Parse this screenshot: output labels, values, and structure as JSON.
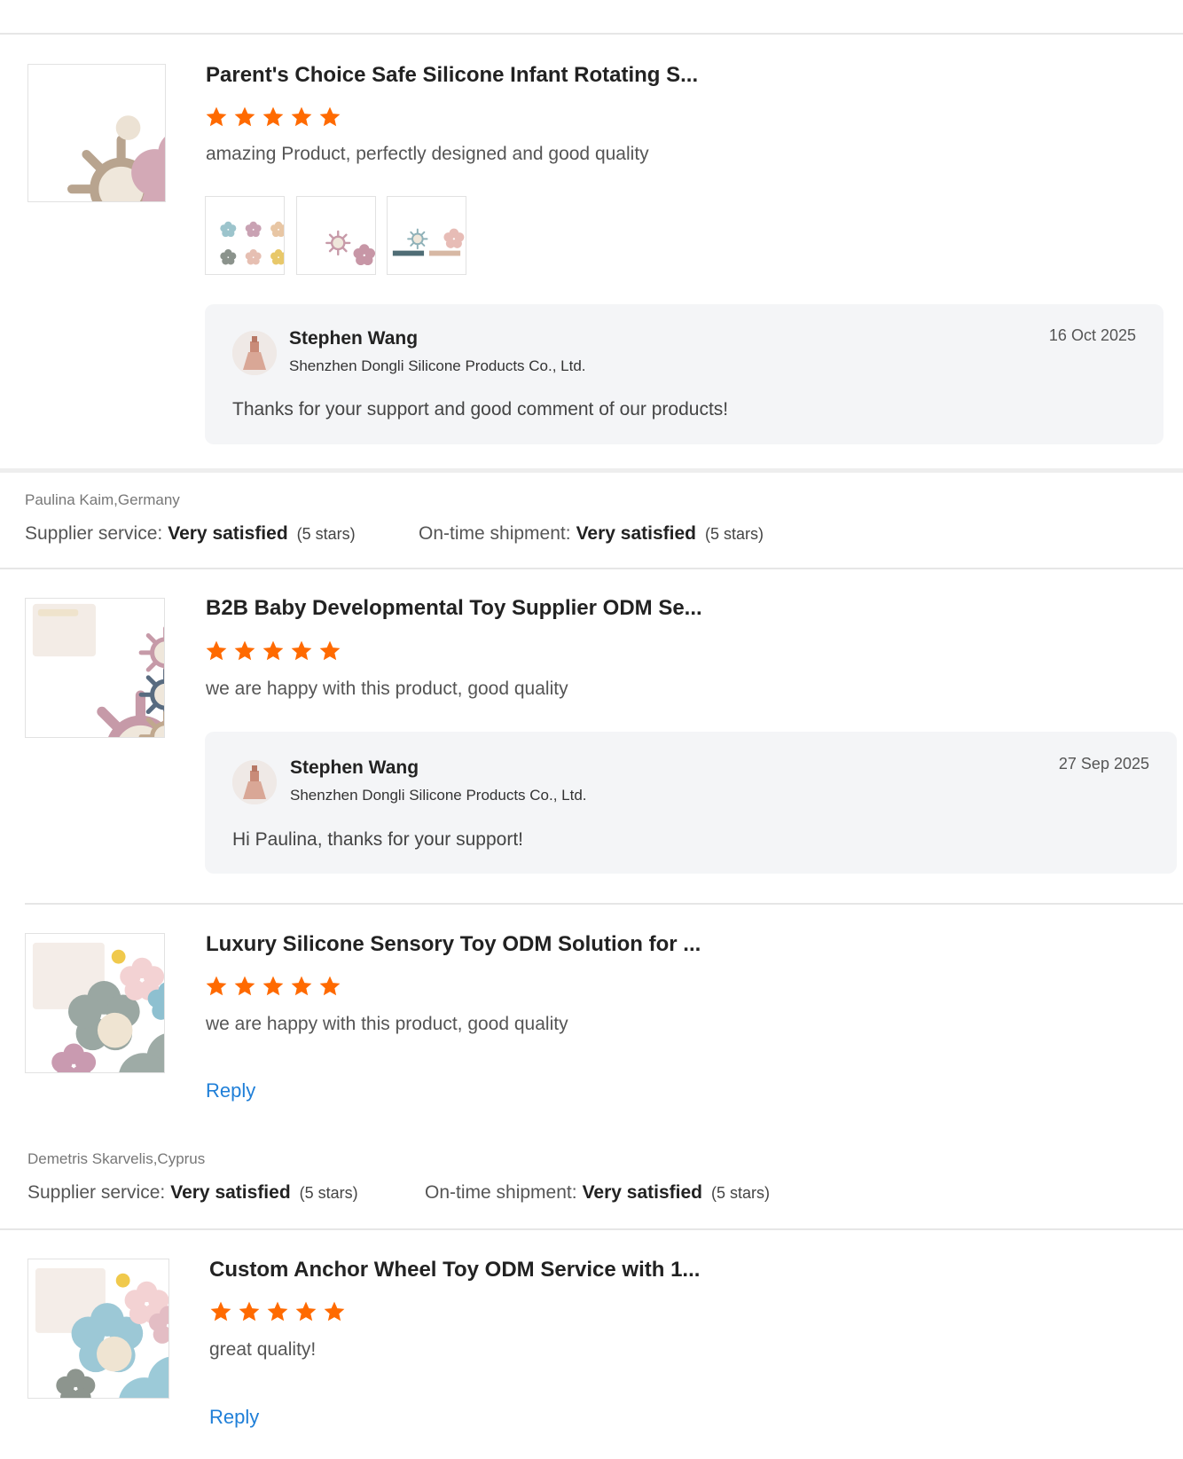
{
  "colors": {
    "star": "#ff6a00",
    "link": "#1f7fd8",
    "reply_bg": "#f4f5f7"
  },
  "reviews": [
    {
      "product_title": "Parent's Choice Safe Silicone Infant Rotating S...",
      "rating": 5,
      "comment": "amazing Product, perfectly designed and good quality",
      "reply": {
        "name": "Stephen Wang",
        "company": "Shenzhen Dongli Silicone Products Co., Ltd.",
        "date": "16 Oct 2025",
        "text": "Thanks for your support and good comment of our products!"
      }
    },
    {
      "product_title": "B2B Baby Developmental Toy Supplier ODM Se...",
      "rating": 5,
      "comment": "we are happy with this product, good quality",
      "reply": {
        "name": "Stephen Wang",
        "company": "Shenzhen Dongli Silicone Products Co., Ltd.",
        "date": "27 Sep 2025",
        "text": "Hi Paulina, thanks for your support!"
      }
    },
    {
      "product_title": "Luxury Silicone Sensory Toy ODM Solution for ...",
      "rating": 5,
      "comment": "we are happy with this product, good quality",
      "reply_link": "Reply"
    },
    {
      "product_title": "Custom Anchor Wheel Toy ODM Service with 1...",
      "rating": 5,
      "comment": "great quality!",
      "reply_link": "Reply"
    }
  ],
  "reviewer_blocks": [
    {
      "reviewer": "Paulina Kaim,Germany",
      "supplier_service": {
        "label": "Supplier service:",
        "value": "Very satisfied",
        "stars_text": "(5 stars)"
      },
      "shipment": {
        "label": "On-time shipment:",
        "value": "Very satisfied",
        "stars_text": "(5 stars)"
      }
    },
    {
      "reviewer": "Demetris Skarvelis,Cyprus",
      "supplier_service": {
        "label": "Supplier service:",
        "value": "Very satisfied",
        "stars_text": "(5 stars)"
      },
      "shipment": {
        "label": "On-time shipment:",
        "value": "Very satisfied",
        "stars_text": "(5 stars)"
      }
    }
  ]
}
